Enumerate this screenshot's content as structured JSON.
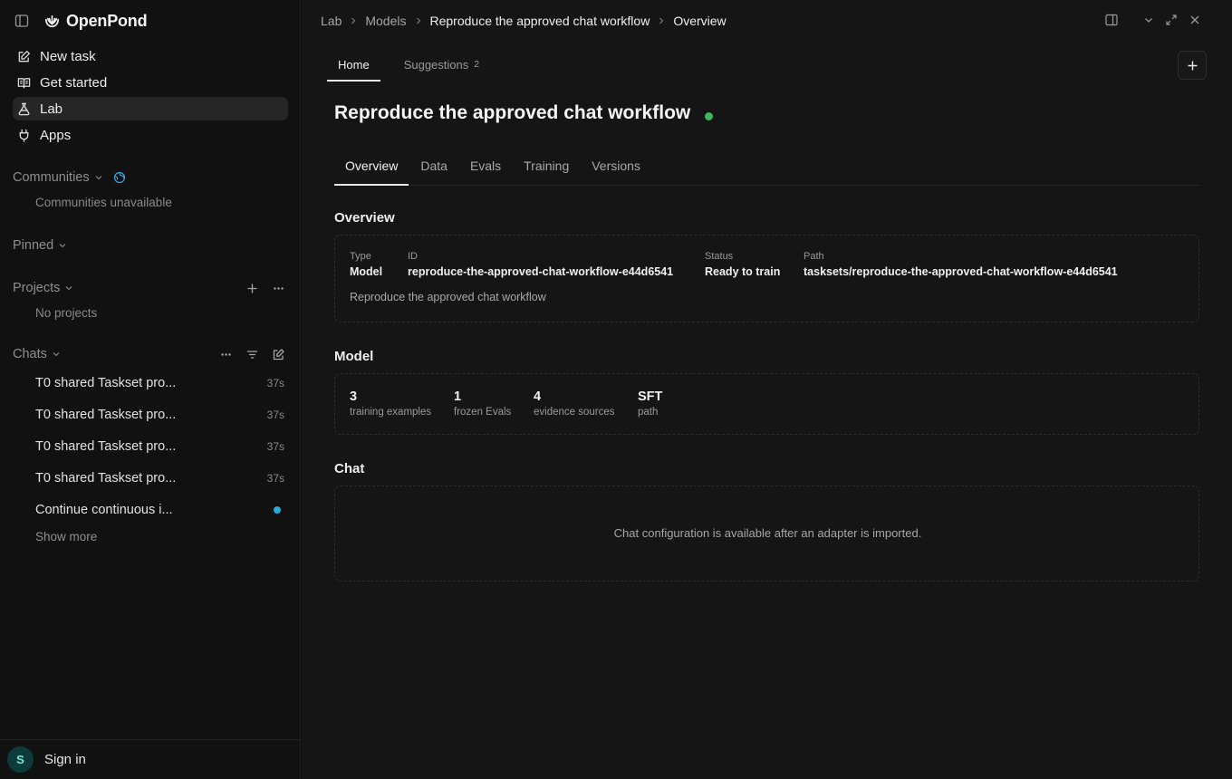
{
  "brand": {
    "name": "OpenPond"
  },
  "nav": [
    {
      "label": "New task",
      "icon": "edit-icon"
    },
    {
      "label": "Get started",
      "icon": "book-icon"
    },
    {
      "label": "Lab",
      "icon": "flask-icon",
      "active": true
    },
    {
      "label": "Apps",
      "icon": "plug-icon"
    }
  ],
  "communities": {
    "label": "Communities",
    "empty": "Communities unavailable"
  },
  "pinned": {
    "label": "Pinned"
  },
  "projects": {
    "label": "Projects",
    "empty": "No projects"
  },
  "chats": {
    "label": "Chats",
    "items": [
      {
        "title": "T0 shared Taskset pro...",
        "time": "37s"
      },
      {
        "title": "T0 shared Taskset pro...",
        "time": "37s"
      },
      {
        "title": "T0 shared Taskset pro...",
        "time": "37s"
      },
      {
        "title": "T0 shared Taskset pro...",
        "time": "37s"
      },
      {
        "title": "Continue continuous i...",
        "time": ""
      }
    ],
    "show_more": "Show more"
  },
  "footer": {
    "avatar_initial": "S",
    "signin": "Sign in"
  },
  "breadcrumb": [
    "Lab",
    "Models",
    "Reproduce the approved chat workflow",
    "Overview"
  ],
  "top_tabs": [
    {
      "label": "Home",
      "active": true
    },
    {
      "label": "Suggestions",
      "count": "2"
    }
  ],
  "page": {
    "title": "Reproduce the approved chat workflow",
    "status_color": "#3fb65e"
  },
  "sub_tabs": [
    "Overview",
    "Data",
    "Evals",
    "Training",
    "Versions"
  ],
  "overview": {
    "heading": "Overview",
    "type_label": "Type",
    "type_value": "Model",
    "id_label": "ID",
    "id_value": "reproduce-the-approved-chat-workflow-e44d6541",
    "status_label": "Status",
    "status_value": "Ready to train",
    "path_label": "Path",
    "path_value": "tasksets/reproduce-the-approved-chat-workflow-e44d6541",
    "description": "Reproduce the approved chat workflow"
  },
  "model": {
    "heading": "Model",
    "stats": [
      {
        "value": "3",
        "label": "training examples"
      },
      {
        "value": "1",
        "label": "frozen Evals"
      },
      {
        "value": "4",
        "label": "evidence sources"
      },
      {
        "value": "SFT",
        "label": "path"
      }
    ]
  },
  "chat": {
    "heading": "Chat",
    "empty": "Chat configuration is available after an adapter is imported."
  },
  "colors": {
    "accent_dot": "#2aa9e0",
    "status_ok": "#3fb65e",
    "avatar_bg": "#0d3b3a"
  }
}
